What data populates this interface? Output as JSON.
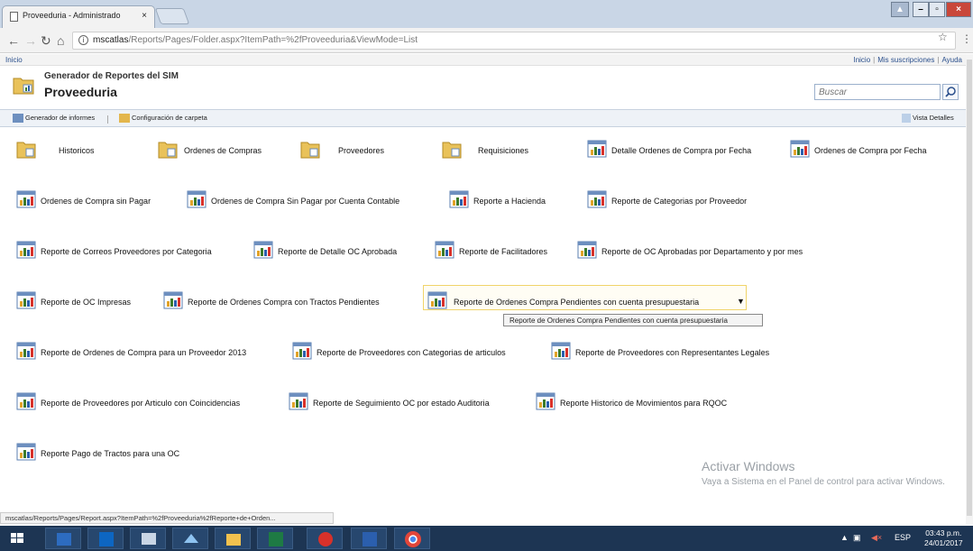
{
  "browser": {
    "tab_title": "Proveeduria - Administrado",
    "tab_close": "×",
    "url_host": "mscatlas",
    "url_path": "/Reports/Pages/Folder.aspx?ItemPath=%2fProveeduria&ViewMode=List",
    "status_url": "mscatlas/Reports/Pages/Report.aspx?ItemPath=%2fProveeduria%2fReporte+de+Orden..."
  },
  "topnav": {
    "home": "Inicio",
    "link_home": "Inicio",
    "link_subscriptions": "Mis suscripciones",
    "link_help": "Ayuda"
  },
  "header": {
    "subtitle": "Generador de Reportes del SIM",
    "title": "Proveeduria",
    "search_placeholder": "Buscar"
  },
  "cmdbar": {
    "report_builder": "Generador de informes",
    "folder_settings": "Configuración de carpeta",
    "details_view": "Vista Detalles"
  },
  "folders": [
    "Historicos",
    "Ordenes de Compras",
    "Proveedores",
    "Requisiciones"
  ],
  "reports": [
    "Detalle Ordenes de Compra por Fecha",
    "Ordenes de Compra por Fecha",
    "Ordenes de Compra sin Pagar",
    "Ordenes de Compra Sin Pagar por Cuenta Contable",
    "Reporte a Hacienda",
    "Reporte de Categorias por Proveedor",
    "Reporte de Correos Proveedores por Categoria",
    "Reporte de Detalle OC Aprobada",
    "Reporte de Facilitadores",
    "Reporte de OC Aprobadas por Departamento y por mes",
    "Reporte de OC Impresas",
    "Reporte de Ordenes Compra con Tractos Pendientes",
    "Reporte de Ordenes Compra Pendientes con cuenta presupuestaria",
    "Reporte de Ordenes de Compra para un Proveedor 2013",
    "Reporte de Proveedores con Categorias de articulos",
    "Reporte de Proveedores con Representantes Legales",
    "Reporte de Proveedores por Articulo con Coincidencias",
    "Reporte de Seguimiento OC por estado Auditoria",
    "Reporte Historico de Movimientos para RQOC",
    "Reporte Pago de Tractos para una OC"
  ],
  "tooltip": "Reporte de Ordenes Compra Pendientes con cuenta presupuestaria",
  "watermark": {
    "title": "Activar Windows",
    "body": "Vaya a Sistema en el Panel de control para activar Windows."
  },
  "taskbar": {
    "lang": "ESP",
    "time": "03:43 p.m.",
    "date": "24/01/2017"
  }
}
